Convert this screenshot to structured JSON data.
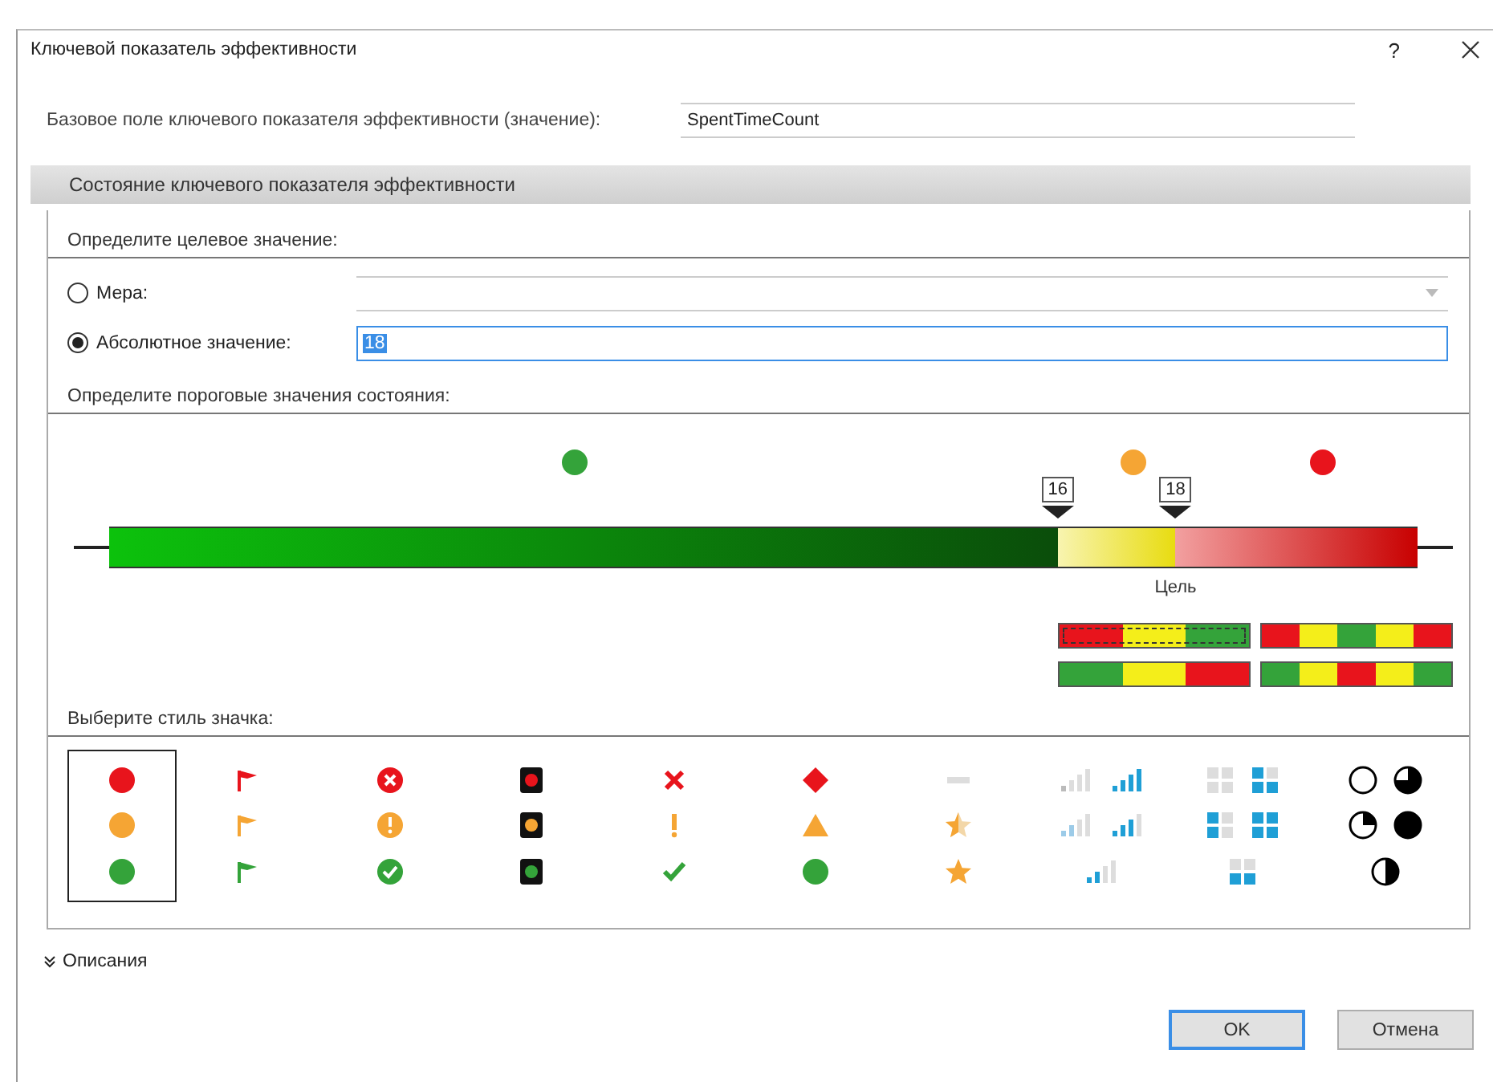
{
  "window": {
    "title": "Ключевой показатель эффективности",
    "help": "?"
  },
  "base_field": {
    "label": "Базовое поле ключевого показателя эффективности (значение):",
    "value": "SpentTimeCount"
  },
  "section": {
    "title": "Состояние ключевого показателя эффективности"
  },
  "target": {
    "heading": "Определите целевое значение:",
    "options": [
      {
        "kind": "measure",
        "label": "Мера:",
        "selected": false
      },
      {
        "kind": "absolute",
        "label": "Абсолютное значение:",
        "selected": true,
        "value": "18"
      }
    ]
  },
  "thresholds": {
    "heading": "Определите пороговые значения состояния:",
    "zones": [
      {
        "color": "#34a33a"
      },
      {
        "color": "#f5a534"
      },
      {
        "color": "#e8141c"
      }
    ],
    "markers": [
      {
        "label": "16",
        "level": 0.725
      },
      {
        "label": "18",
        "level": 0.815
      }
    ],
    "target_label": "Цель",
    "presets": [
      {
        "kind": "red-yellow-green",
        "selected": true
      },
      {
        "kind": "red-yellow-green-yellow-red",
        "selected": false
      },
      {
        "kind": "green-yellow-red",
        "selected": false
      },
      {
        "kind": "green-yellow-red-yellow-green",
        "selected": false
      }
    ]
  },
  "icon_styles": {
    "heading": "Выберите стиль значка:",
    "options": [
      {
        "kind": "circles",
        "selected": true
      },
      {
        "kind": "flags",
        "selected": false
      },
      {
        "kind": "symbols",
        "selected": false
      },
      {
        "kind": "lights",
        "selected": false
      },
      {
        "kind": "marks",
        "selected": false
      },
      {
        "kind": "shapes",
        "selected": false
      },
      {
        "kind": "stars",
        "selected": false
      },
      {
        "kind": "signal",
        "selected": false
      },
      {
        "kind": "grid",
        "selected": false
      },
      {
        "kind": "pies",
        "selected": false
      }
    ]
  },
  "descriptions": {
    "label": "Описания",
    "expanded": false
  },
  "buttons": [
    {
      "label": "OK",
      "default": true
    },
    {
      "label": "Отмена",
      "default": false
    }
  ]
}
